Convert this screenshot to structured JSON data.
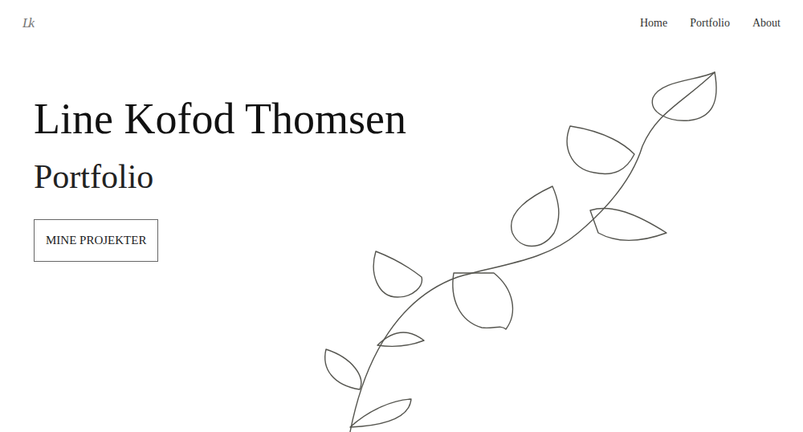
{
  "logo": "Lk",
  "nav": [
    {
      "label": "Home"
    },
    {
      "label": "Portfolio"
    },
    {
      "label": "About"
    }
  ],
  "hero": {
    "title": "Line Kofod Thomsen",
    "subtitle": "Portfolio",
    "button": "MINE PROJEKTER"
  }
}
